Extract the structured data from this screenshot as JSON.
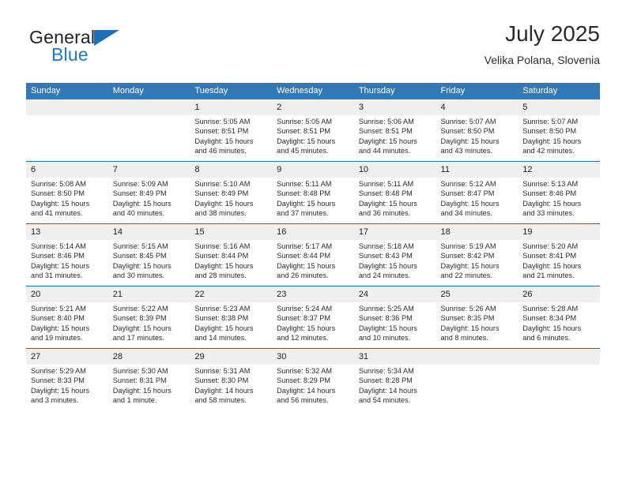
{
  "brand": {
    "name_top": "General",
    "name_bottom": "Blue",
    "accent_color": "#1d70b8"
  },
  "header": {
    "month_title": "July 2025",
    "location": "Velika Polana, Slovenia"
  },
  "theme": {
    "header_bg": "#3479b5",
    "row_divider": "#2e6da4",
    "daynum_bg": "#efefef",
    "text": "#2b2b2b"
  },
  "weekday_headers": [
    "Sunday",
    "Monday",
    "Tuesday",
    "Wednesday",
    "Thursday",
    "Friday",
    "Saturday"
  ],
  "weeks": [
    [
      {
        "day": "",
        "sunrise": "",
        "sunset": "",
        "daylight_1": "",
        "daylight_2": "",
        "blank": true
      },
      {
        "day": "",
        "sunrise": "",
        "sunset": "",
        "daylight_1": "",
        "daylight_2": "",
        "blank": true
      },
      {
        "day": "1",
        "sunrise": "Sunrise: 5:05 AM",
        "sunset": "Sunset: 8:51 PM",
        "daylight_1": "Daylight: 15 hours",
        "daylight_2": "and 46 minutes."
      },
      {
        "day": "2",
        "sunrise": "Sunrise: 5:05 AM",
        "sunset": "Sunset: 8:51 PM",
        "daylight_1": "Daylight: 15 hours",
        "daylight_2": "and 45 minutes."
      },
      {
        "day": "3",
        "sunrise": "Sunrise: 5:06 AM",
        "sunset": "Sunset: 8:51 PM",
        "daylight_1": "Daylight: 15 hours",
        "daylight_2": "and 44 minutes."
      },
      {
        "day": "4",
        "sunrise": "Sunrise: 5:07 AM",
        "sunset": "Sunset: 8:50 PM",
        "daylight_1": "Daylight: 15 hours",
        "daylight_2": "and 43 minutes."
      },
      {
        "day": "5",
        "sunrise": "Sunrise: 5:07 AM",
        "sunset": "Sunset: 8:50 PM",
        "daylight_1": "Daylight: 15 hours",
        "daylight_2": "and 42 minutes."
      }
    ],
    [
      {
        "day": "6",
        "sunrise": "Sunrise: 5:08 AM",
        "sunset": "Sunset: 8:50 PM",
        "daylight_1": "Daylight: 15 hours",
        "daylight_2": "and 41 minutes."
      },
      {
        "day": "7",
        "sunrise": "Sunrise: 5:09 AM",
        "sunset": "Sunset: 8:49 PM",
        "daylight_1": "Daylight: 15 hours",
        "daylight_2": "and 40 minutes."
      },
      {
        "day": "8",
        "sunrise": "Sunrise: 5:10 AM",
        "sunset": "Sunset: 8:49 PM",
        "daylight_1": "Daylight: 15 hours",
        "daylight_2": "and 38 minutes."
      },
      {
        "day": "9",
        "sunrise": "Sunrise: 5:11 AM",
        "sunset": "Sunset: 8:48 PM",
        "daylight_1": "Daylight: 15 hours",
        "daylight_2": "and 37 minutes."
      },
      {
        "day": "10",
        "sunrise": "Sunrise: 5:11 AM",
        "sunset": "Sunset: 8:48 PM",
        "daylight_1": "Daylight: 15 hours",
        "daylight_2": "and 36 minutes."
      },
      {
        "day": "11",
        "sunrise": "Sunrise: 5:12 AM",
        "sunset": "Sunset: 8:47 PM",
        "daylight_1": "Daylight: 15 hours",
        "daylight_2": "and 34 minutes."
      },
      {
        "day": "12",
        "sunrise": "Sunrise: 5:13 AM",
        "sunset": "Sunset: 8:46 PM",
        "daylight_1": "Daylight: 15 hours",
        "daylight_2": "and 33 minutes."
      }
    ],
    [
      {
        "day": "13",
        "sunrise": "Sunrise: 5:14 AM",
        "sunset": "Sunset: 8:46 PM",
        "daylight_1": "Daylight: 15 hours",
        "daylight_2": "and 31 minutes."
      },
      {
        "day": "14",
        "sunrise": "Sunrise: 5:15 AM",
        "sunset": "Sunset: 8:45 PM",
        "daylight_1": "Daylight: 15 hours",
        "daylight_2": "and 30 minutes."
      },
      {
        "day": "15",
        "sunrise": "Sunrise: 5:16 AM",
        "sunset": "Sunset: 8:44 PM",
        "daylight_1": "Daylight: 15 hours",
        "daylight_2": "and 28 minutes."
      },
      {
        "day": "16",
        "sunrise": "Sunrise: 5:17 AM",
        "sunset": "Sunset: 8:44 PM",
        "daylight_1": "Daylight: 15 hours",
        "daylight_2": "and 26 minutes."
      },
      {
        "day": "17",
        "sunrise": "Sunrise: 5:18 AM",
        "sunset": "Sunset: 8:43 PM",
        "daylight_1": "Daylight: 15 hours",
        "daylight_2": "and 24 minutes."
      },
      {
        "day": "18",
        "sunrise": "Sunrise: 5:19 AM",
        "sunset": "Sunset: 8:42 PM",
        "daylight_1": "Daylight: 15 hours",
        "daylight_2": "and 22 minutes."
      },
      {
        "day": "19",
        "sunrise": "Sunrise: 5:20 AM",
        "sunset": "Sunset: 8:41 PM",
        "daylight_1": "Daylight: 15 hours",
        "daylight_2": "and 21 minutes."
      }
    ],
    [
      {
        "day": "20",
        "sunrise": "Sunrise: 5:21 AM",
        "sunset": "Sunset: 8:40 PM",
        "daylight_1": "Daylight: 15 hours",
        "daylight_2": "and 19 minutes."
      },
      {
        "day": "21",
        "sunrise": "Sunrise: 5:22 AM",
        "sunset": "Sunset: 8:39 PM",
        "daylight_1": "Daylight: 15 hours",
        "daylight_2": "and 17 minutes."
      },
      {
        "day": "22",
        "sunrise": "Sunrise: 5:23 AM",
        "sunset": "Sunset: 8:38 PM",
        "daylight_1": "Daylight: 15 hours",
        "daylight_2": "and 14 minutes."
      },
      {
        "day": "23",
        "sunrise": "Sunrise: 5:24 AM",
        "sunset": "Sunset: 8:37 PM",
        "daylight_1": "Daylight: 15 hours",
        "daylight_2": "and 12 minutes."
      },
      {
        "day": "24",
        "sunrise": "Sunrise: 5:25 AM",
        "sunset": "Sunset: 8:36 PM",
        "daylight_1": "Daylight: 15 hours",
        "daylight_2": "and 10 minutes."
      },
      {
        "day": "25",
        "sunrise": "Sunrise: 5:26 AM",
        "sunset": "Sunset: 8:35 PM",
        "daylight_1": "Daylight: 15 hours",
        "daylight_2": "and 8 minutes."
      },
      {
        "day": "26",
        "sunrise": "Sunrise: 5:28 AM",
        "sunset": "Sunset: 8:34 PM",
        "daylight_1": "Daylight: 15 hours",
        "daylight_2": "and 6 minutes."
      }
    ],
    [
      {
        "day": "27",
        "sunrise": "Sunrise: 5:29 AM",
        "sunset": "Sunset: 8:33 PM",
        "daylight_1": "Daylight: 15 hours",
        "daylight_2": "and 3 minutes."
      },
      {
        "day": "28",
        "sunrise": "Sunrise: 5:30 AM",
        "sunset": "Sunset: 8:31 PM",
        "daylight_1": "Daylight: 15 hours",
        "daylight_2": "and 1 minute."
      },
      {
        "day": "29",
        "sunrise": "Sunrise: 5:31 AM",
        "sunset": "Sunset: 8:30 PM",
        "daylight_1": "Daylight: 14 hours",
        "daylight_2": "and 58 minutes."
      },
      {
        "day": "30",
        "sunrise": "Sunrise: 5:32 AM",
        "sunset": "Sunset: 8:29 PM",
        "daylight_1": "Daylight: 14 hours",
        "daylight_2": "and 56 minutes."
      },
      {
        "day": "31",
        "sunrise": "Sunrise: 5:34 AM",
        "sunset": "Sunset: 8:28 PM",
        "daylight_1": "Daylight: 14 hours",
        "daylight_2": "and 54 minutes."
      },
      {
        "day": "",
        "sunrise": "",
        "sunset": "",
        "daylight_1": "",
        "daylight_2": "",
        "blank": true
      },
      {
        "day": "",
        "sunrise": "",
        "sunset": "",
        "daylight_1": "",
        "daylight_2": "",
        "blank": true
      }
    ]
  ]
}
